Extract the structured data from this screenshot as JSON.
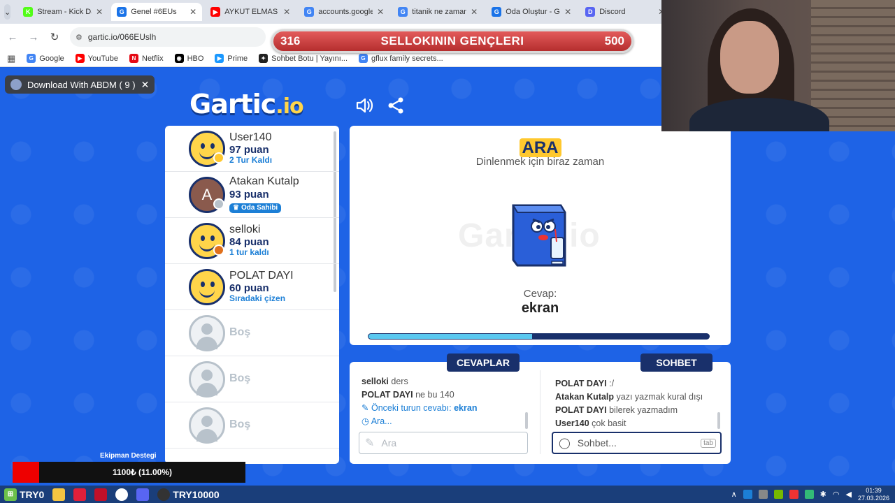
{
  "browser": {
    "tabs": [
      {
        "title": "Stream - Kick Da",
        "fav_color": "#53fc18",
        "fav_glyph": "K",
        "active": false
      },
      {
        "title": "Genel #6EUs",
        "fav_color": "#1a73e8",
        "fav_glyph": "G",
        "active": true
      },
      {
        "title": "AYKUT ELMAS H",
        "fav_color": "#ff0000",
        "fav_glyph": "▶",
        "active": false
      },
      {
        "title": "accounts.google",
        "fav_color": "#4285f4",
        "fav_glyph": "G",
        "active": false
      },
      {
        "title": "titanik ne zaman",
        "fav_color": "#4285f4",
        "fav_glyph": "G",
        "active": false
      },
      {
        "title": "Oda Oluştur - Ga",
        "fav_color": "#1a73e8",
        "fav_glyph": "G",
        "active": false
      },
      {
        "title": "Discord",
        "fav_color": "#5865f2",
        "fav_glyph": "D",
        "active": false
      }
    ],
    "url": "gartic.io/066EUslh",
    "bookmarks": [
      {
        "label": "Google",
        "color": "#4285f4",
        "glyph": "G"
      },
      {
        "label": "YouTube",
        "color": "#ff0000",
        "glyph": "▶"
      },
      {
        "label": "Netflix",
        "color": "#e50914",
        "glyph": "N"
      },
      {
        "label": "HBO",
        "color": "#000000",
        "glyph": "◉"
      },
      {
        "label": "Prime",
        "color": "#1a98ff",
        "glyph": "▶"
      },
      {
        "label": "Sohbet Botu | Yayını...",
        "color": "#222222",
        "glyph": "✦"
      },
      {
        "label": "gflux family secrets...",
        "color": "#4285f4",
        "glyph": "G"
      }
    ]
  },
  "overlay": {
    "left_num": "316",
    "title": "SELLOKININ GENÇLERI",
    "right_num": "500"
  },
  "abdm": {
    "label": "Download With ABDM ( 9 )"
  },
  "logo": {
    "text": "Gartic",
    "suffix": ".io"
  },
  "players": [
    {
      "name": "User140",
      "points": "97 puan",
      "sub": "2 Tur Kaldı",
      "avatar": "smile",
      "dot": "#ffc82e"
    },
    {
      "name": "Atakan Kutalp",
      "points": "93 puan",
      "badge": "Oda Sahibi",
      "avatar": "letter",
      "letter": "A",
      "dot": "#b8c2cb"
    },
    {
      "name": "selloki",
      "points": "84 puan",
      "sub": "1 tur kaldı",
      "avatar": "smile",
      "dot": "#e0701c"
    },
    {
      "name": "POLAT DAYI",
      "points": "60 puan",
      "sub": "Sıradaki çizen",
      "avatar": "smile"
    },
    {
      "name": "Boş",
      "avatar": "empty"
    },
    {
      "name": "Boş",
      "avatar": "empty"
    },
    {
      "name": "Boş",
      "avatar": "empty"
    }
  ],
  "game": {
    "status": "ARA",
    "subtitle": "Dinlenmek için biraz zaman",
    "watermark": "Gartic.io",
    "answer_label": "Cevap:",
    "answer": "ekran",
    "progress_fraction": 0.48
  },
  "answers_panel": {
    "title": "CEVAPLAR",
    "messages": [
      {
        "user": "selloki",
        "text": "ders"
      },
      {
        "user": "POLAT DAYI",
        "text": "ne bu 140"
      }
    ],
    "prev_answer_label": "Önceki turun cevabı:",
    "prev_answer": "ekran",
    "searching": "Ara...",
    "input_placeholder": "Ara"
  },
  "chat_panel": {
    "title": "SOHBET",
    "messages": [
      {
        "user": "POLAT DAYI",
        "text": ":/"
      },
      {
        "user": "Atakan Kutalp",
        "text": "yazı yazmak kural dışı"
      },
      {
        "user": "POLAT DAYI",
        "text": "bilerek yazmadım"
      },
      {
        "user": "User140",
        "text": "çok basit"
      }
    ],
    "input_placeholder": "Sohbet...",
    "tab_hint": "tab"
  },
  "stream": {
    "equipment_label": "Ekipman Destegi",
    "donation_text": "1100₺ (11.00%)"
  },
  "taskbar": {
    "start_label": "TRY0",
    "app_label": "TRY10000",
    "time": "01:39",
    "date": "27.03.2026"
  }
}
